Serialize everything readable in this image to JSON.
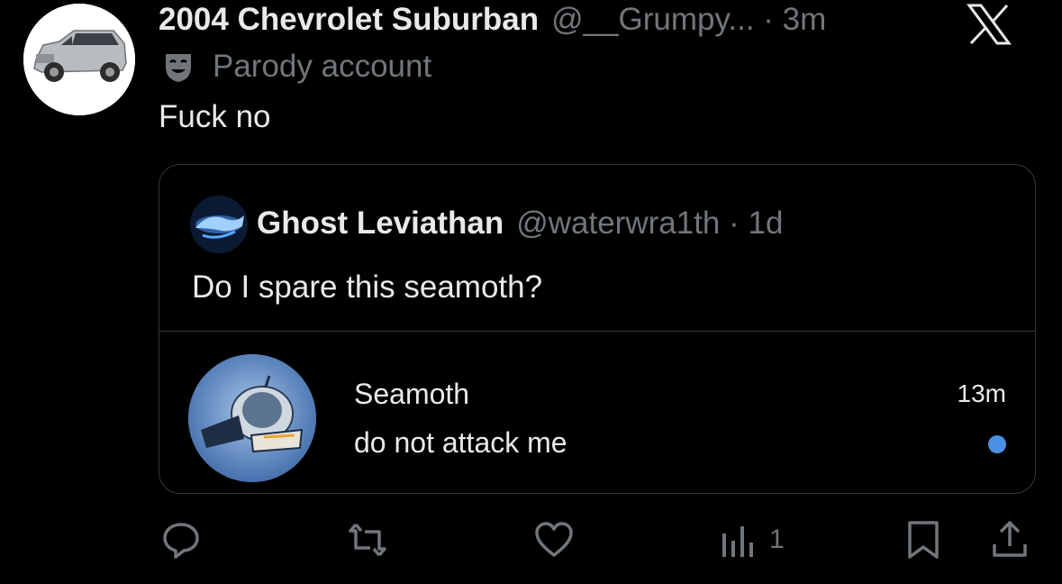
{
  "tweet": {
    "display_name": "2004 Chevrolet Suburban",
    "handle_time": "@__Grumpy... · 3m",
    "label": "Parody account",
    "text": "Fuck no"
  },
  "quote": {
    "display_name": "Ghost Leviathan",
    "handle_time": "@waterwra1th · 1d",
    "text": "Do I spare this seamoth?",
    "notification": {
      "title": "Seamoth",
      "body": "do not attack me",
      "time": "13m"
    }
  },
  "actions": {
    "views_count": "1"
  },
  "colors": {
    "background": "#000000",
    "text": "#e7e9ea",
    "muted": "#71767b",
    "border": "#333639",
    "unread_dot": "#4a90e2"
  }
}
